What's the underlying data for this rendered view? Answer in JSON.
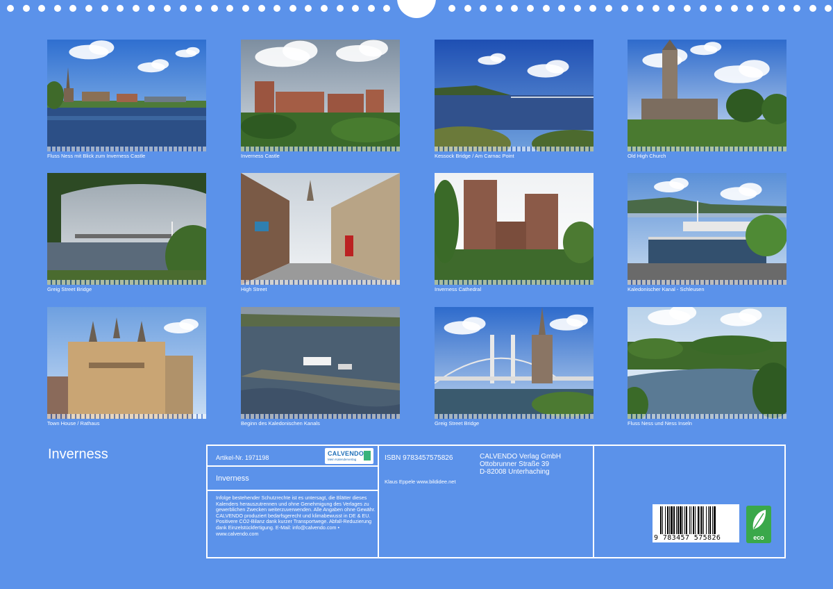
{
  "calendar": {
    "title": "Inverness",
    "tiles": [
      {
        "caption": "Fluss Ness mit Blick zum Inverness Castle",
        "scene": "river-town"
      },
      {
        "caption": "Inverness Castle",
        "scene": "castle"
      },
      {
        "caption": "Kessock Bridge / Am Carnac Point",
        "scene": "water-bridge"
      },
      {
        "caption": "Old High Church",
        "scene": "church"
      },
      {
        "caption": "Greig Street Bridge",
        "scene": "tree-frame-bridge"
      },
      {
        "caption": "High Street",
        "scene": "street"
      },
      {
        "caption": "Inverness Cathedral",
        "scene": "cathedral"
      },
      {
        "caption": "Kaledonischer Kanal - Schleusen",
        "scene": "lock"
      },
      {
        "caption": "Town House / Rathaus",
        "scene": "town-house"
      },
      {
        "caption": "Beginn des Kaledonischen Kanals",
        "scene": "canal-mouth"
      },
      {
        "caption": "Greig Street Bridge",
        "scene": "suspension-bridge"
      },
      {
        "caption": "Fluss Ness und Ness Inseln",
        "scene": "river-trees"
      }
    ]
  },
  "info": {
    "article_no": "Artikel-Nr. 1971198",
    "title": "Inverness",
    "isbn": "ISBN 9783457575826",
    "author": "Klaus Eppele www.bildidee.net",
    "publisher_lines": [
      "CALVENDO Verlag GmbH",
      "Ottobrunner Straße 39",
      "D-82008 Unterhaching"
    ],
    "legal": "Infolge bestehender Schutzrechte ist es untersagt, die Blätter dieses Kalenders herauszutrennen und ohne Genehmigung des Verlages zu gewerblichen Zwecken weiterzuverwenden. Alle Angaben ohne Gewähr. CALVENDO produziert bedarfsgerecht und klimabewusst in DE & EU. Positivere CO2-Bilanz dank kurzer Transportwege. Abfall-Reduzierung dank Einzelstückfertigung. E-Mail: info@calvendo.com • www.calvendo.com",
    "logo_name": "CALVENDO",
    "logo_sub": "Mein Kalenderverlag",
    "barcode_number": "9 783457 575826",
    "eco_label": "eco"
  },
  "colors": {
    "background": "#5b92ea",
    "eco_green": "#3aa84a"
  }
}
